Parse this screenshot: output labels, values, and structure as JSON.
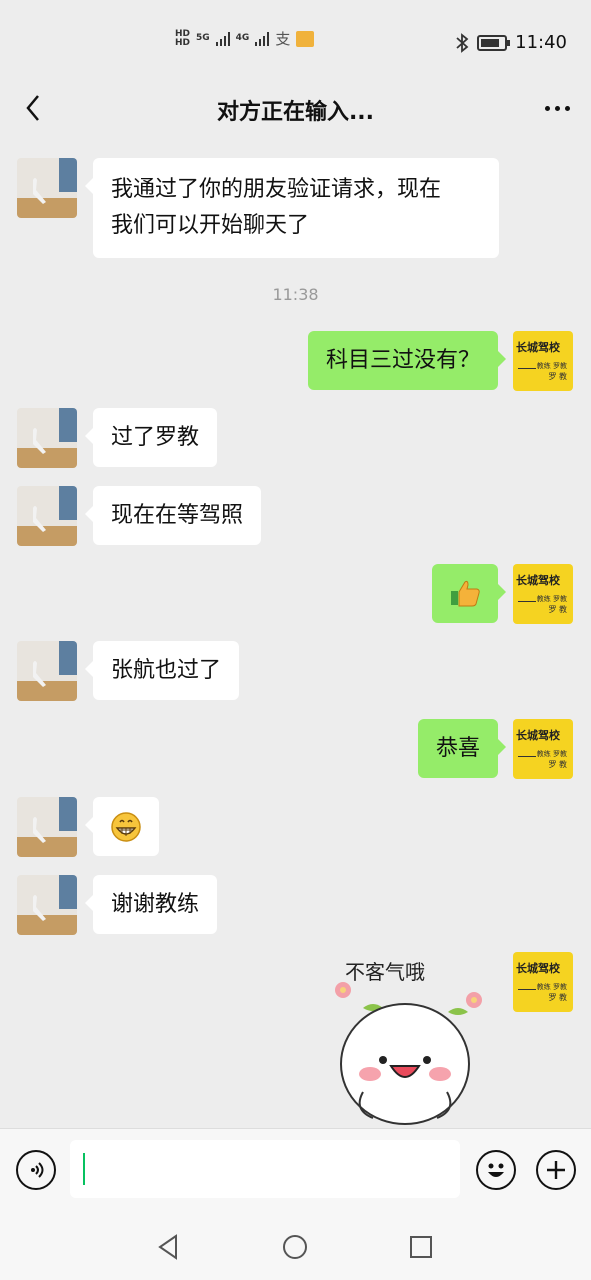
{
  "status": {
    "hd1": "HD",
    "hd2": "HD",
    "net1": "5G",
    "net2": "4G",
    "alipay_label": "支",
    "time": "11:40"
  },
  "header": {
    "title": "对方正在输入..."
  },
  "messages": [
    {
      "side": "left",
      "text": "我通过了你的朋友验证请求，现在\n我们可以开始聊天了"
    },
    {
      "side": "time",
      "text": "11:38"
    },
    {
      "side": "right",
      "text": "科目三过没有？"
    },
    {
      "side": "left",
      "text": "过了罗教"
    },
    {
      "side": "left",
      "text": "现在在等驾照"
    },
    {
      "side": "right",
      "emoji": "thumbs-up",
      "text": "👍"
    },
    {
      "side": "left",
      "text": "张航也过了"
    },
    {
      "side": "right",
      "text": "恭喜"
    },
    {
      "side": "left",
      "emoji": "grin",
      "text": "😁"
    },
    {
      "side": "left",
      "text": "谢谢教练"
    },
    {
      "side": "right",
      "sticker": "不客气哦"
    }
  ],
  "self_avatar": {
    "line1": "长城驾校",
    "line2": "教练 罗教",
    "line3": "罗 教"
  },
  "colors": {
    "right_bubble": "#95ec69",
    "left_bubble": "#ffffff",
    "background": "#ededed",
    "cursor": "#07c160",
    "avatar_bg": "#f5d321"
  }
}
